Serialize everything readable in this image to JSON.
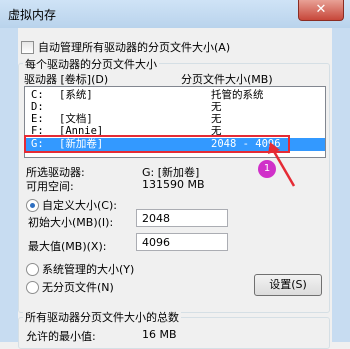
{
  "window": {
    "title": "虚拟内存",
    "close_glyph": "✕"
  },
  "auto_manage": {
    "label": "自动管理所有驱动器的分页文件大小(A)",
    "checked": false
  },
  "drive_group": {
    "title": "每个驱动器的分页文件大小"
  },
  "drive_list": {
    "header_drive": "驱动器 [卷标](D)",
    "header_size": "分页文件大小(MB)",
    "rows": [
      {
        "drive": "C:",
        "label": "[系统]",
        "size": "托管的系统"
      },
      {
        "drive": "D:",
        "label": "",
        "size": "无"
      },
      {
        "drive": "E:",
        "label": "[文档]",
        "size": "无"
      },
      {
        "drive": "F:",
        "label": "[Annie]",
        "size": "无"
      },
      {
        "drive": "G:",
        "label": "[新加卷]",
        "size": "2048 - 4096"
      }
    ]
  },
  "annotation": {
    "number": "1",
    "accent": "#e52b35"
  },
  "selected_drive": {
    "label": "所选驱动器:",
    "value": "G:  [新加卷]",
    "free_label": "可用空间:",
    "free_value": "131590 MB"
  },
  "custom_size": {
    "radio_label": "自定义大小(C):",
    "initial_label": "初始大小(MB)(I):",
    "initial_value": "2048",
    "max_label": "最大值(MB)(X):",
    "max_value": "4096"
  },
  "system_managed": {
    "label": "系统管理的大小(Y)"
  },
  "no_paging": {
    "label": "无分页文件(N)"
  },
  "set_button": {
    "label": "设置(S)"
  },
  "total_group": {
    "title": "所有驱动器分页文件大小的总数",
    "min_label": "允许的最小值:",
    "min_value": "16 MB"
  }
}
